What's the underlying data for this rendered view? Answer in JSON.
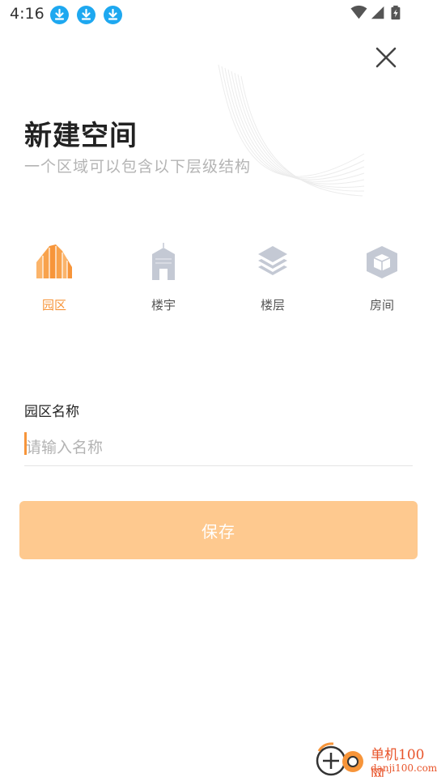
{
  "status_bar": {
    "time": "4:16",
    "notification_icons": [
      "download-icon",
      "download-icon",
      "download-icon"
    ],
    "system_icons": [
      "wifi-icon",
      "cellular-signal-icon",
      "battery-charging-icon"
    ]
  },
  "header": {
    "title": "新建空间",
    "subtitle": "一个区域可以包含以下层级结构"
  },
  "space_types": [
    {
      "label": "园区",
      "icon": "park-buildings-icon",
      "active": true
    },
    {
      "label": "楼宇",
      "icon": "building-icon",
      "active": false
    },
    {
      "label": "楼层",
      "icon": "floor-layers-icon",
      "active": false
    },
    {
      "label": "房间",
      "icon": "room-cube-icon",
      "active": false
    }
  ],
  "form": {
    "field_label": "园区名称",
    "input_placeholder": "请输入名称",
    "input_value": ""
  },
  "save_label": "保存",
  "watermark": {
    "name": "单机100网",
    "url": "danji100.com"
  },
  "colors": {
    "accent": "#f7953a",
    "save_disabled_bg": "#fec98f",
    "inactive_icon": "#c4c9d4",
    "download_badge": "#1ea8f0"
  }
}
